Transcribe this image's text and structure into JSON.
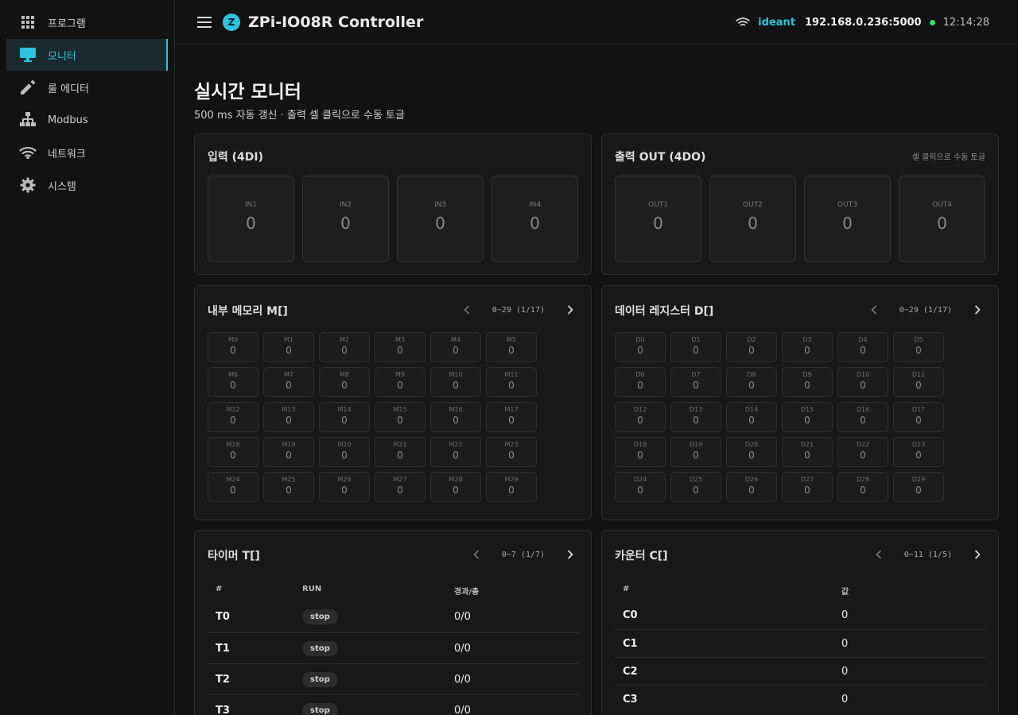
{
  "sidebar": {
    "items": [
      {
        "label": "프로그램",
        "icon": "apps-grid-icon"
      },
      {
        "label": "모니터",
        "icon": "monitor-icon",
        "active": true
      },
      {
        "label": "룰 에디터",
        "icon": "pencil-icon"
      },
      {
        "label": "Modbus",
        "icon": "network-tree-icon"
      },
      {
        "label": "네트워크",
        "icon": "wifi-icon"
      },
      {
        "label": "시스템",
        "icon": "gear-icon"
      }
    ]
  },
  "header": {
    "logo_letter": "Z",
    "title": "ZPi-IO08R Controller",
    "user": "ideant",
    "host": "192.168.0.236:5000",
    "time": "12:14:28"
  },
  "page": {
    "title": "실시간 모니터",
    "subtitle": "500 ms 자동 갱신 · 출력 셀 클릭으로 수동 토글"
  },
  "inputs": {
    "title": "입력 (4DI)",
    "cells": [
      {
        "label": "IN1",
        "value": "0"
      },
      {
        "label": "IN2",
        "value": "0"
      },
      {
        "label": "IN3",
        "value": "0"
      },
      {
        "label": "IN4",
        "value": "0"
      }
    ]
  },
  "outputs": {
    "title": "출력 OUT (4DO)",
    "hint": "셀 클릭으로 수동 토글",
    "cells": [
      {
        "label": "OUT1",
        "value": "0"
      },
      {
        "label": "OUT2",
        "value": "0"
      },
      {
        "label": "OUT3",
        "value": "0"
      },
      {
        "label": "OUT4",
        "value": "0"
      }
    ]
  },
  "memory": {
    "title": "내부 메모리 M[]",
    "range": "0~29 (1/17)",
    "prefix": "M",
    "values": [
      "0",
      "0",
      "0",
      "0",
      "0",
      "0",
      "0",
      "0",
      "0",
      "0",
      "0",
      "0",
      "0",
      "0",
      "0",
      "0",
      "0",
      "0",
      "0",
      "0",
      "0",
      "0",
      "0",
      "0",
      "0",
      "0",
      "0",
      "0",
      "0",
      "0"
    ]
  },
  "registers": {
    "title": "데이터 레지스터 D[]",
    "range": "0~29 (1/17)",
    "prefix": "D",
    "values": [
      "0",
      "0",
      "0",
      "0",
      "0",
      "0",
      "0",
      "0",
      "0",
      "0",
      "0",
      "0",
      "0",
      "0",
      "0",
      "0",
      "0",
      "0",
      "0",
      "0",
      "0",
      "0",
      "0",
      "0",
      "0",
      "0",
      "0",
      "0",
      "0",
      "0"
    ]
  },
  "timers": {
    "title": "타이머 T[]",
    "range": "0~7 (1/7)",
    "headers": [
      "#",
      "RUN",
      "경과/총"
    ],
    "rows": [
      {
        "name": "T0",
        "run": "stop",
        "elapsed": "0/0"
      },
      {
        "name": "T1",
        "run": "stop",
        "elapsed": "0/0"
      },
      {
        "name": "T2",
        "run": "stop",
        "elapsed": "0/0"
      },
      {
        "name": "T3",
        "run": "stop",
        "elapsed": "0/0"
      }
    ]
  },
  "counters": {
    "title": "카운터 C[]",
    "range": "0~11 (1/5)",
    "headers": [
      "#",
      "값"
    ],
    "rows": [
      {
        "name": "C0",
        "value": "0"
      },
      {
        "name": "C1",
        "value": "0"
      },
      {
        "name": "C2",
        "value": "0"
      },
      {
        "name": "C3",
        "value": "0"
      }
    ]
  },
  "colors": {
    "accent": "#2bc4dc",
    "online": "#2ee86e",
    "background": "#121212",
    "card": "#181818"
  }
}
